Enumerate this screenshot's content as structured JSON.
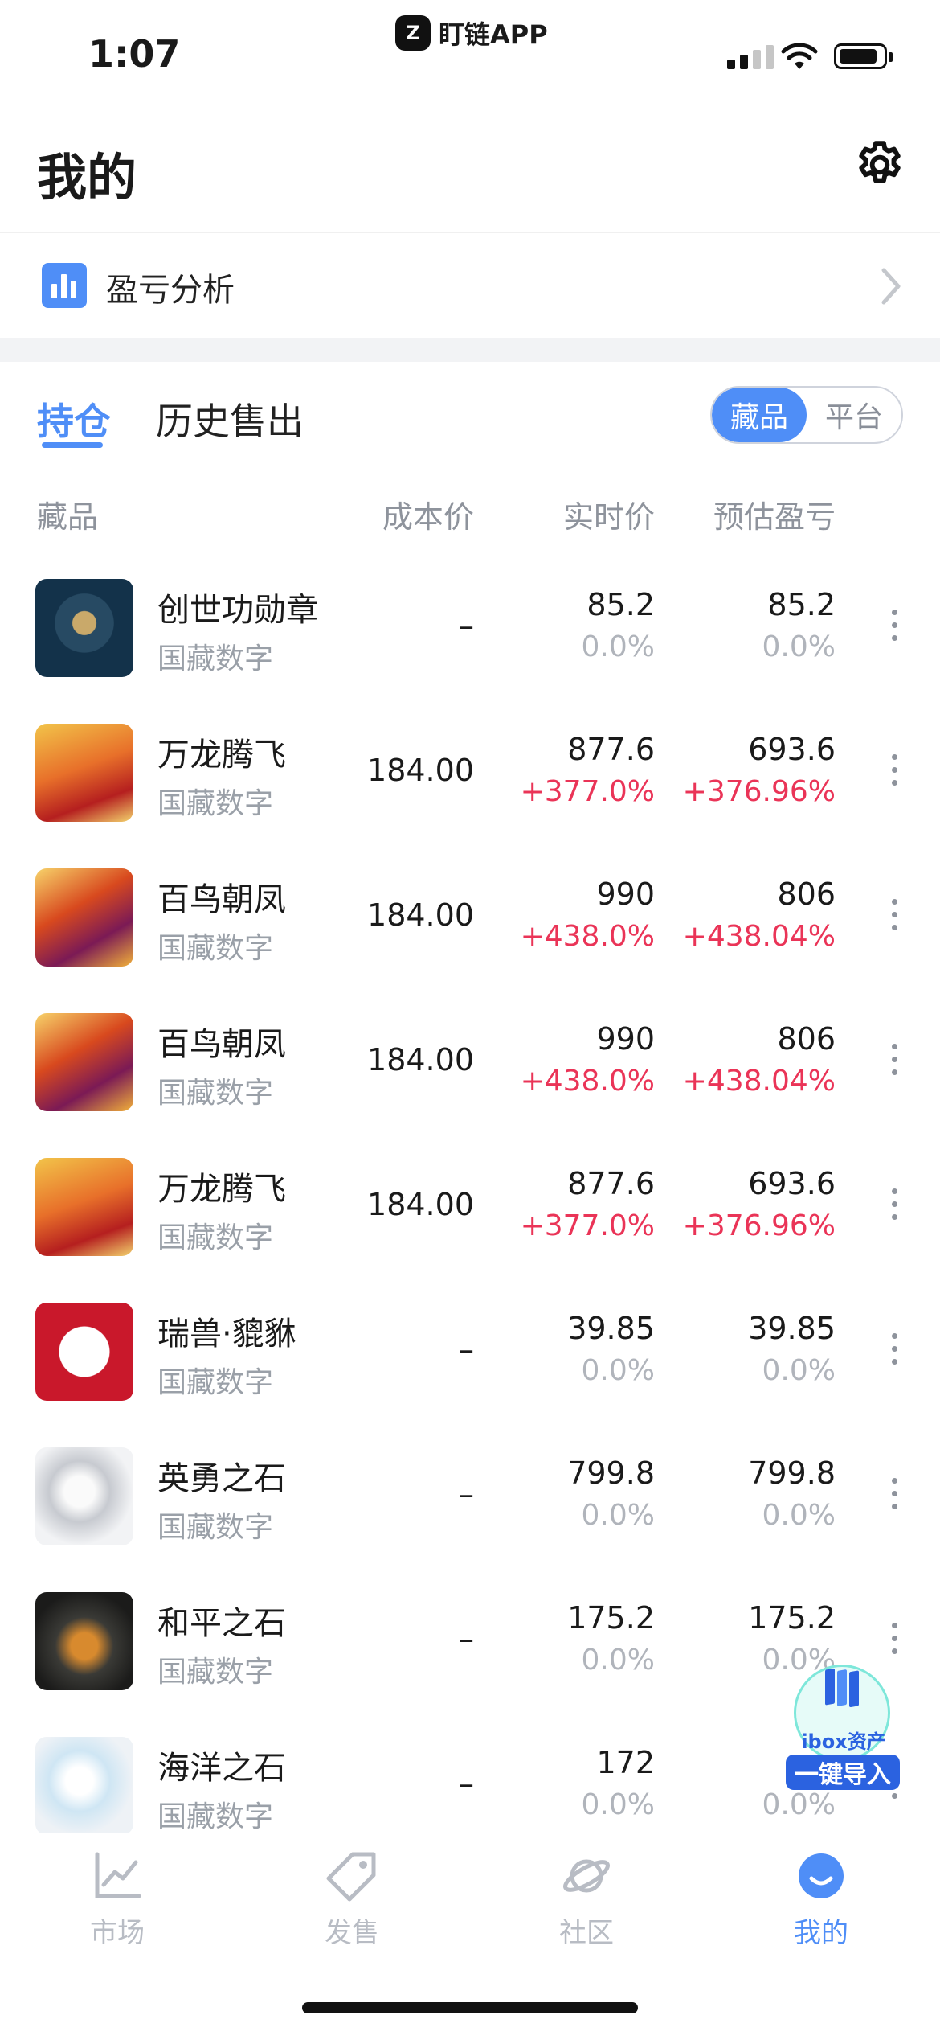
{
  "status_bar": {
    "time": "1:07",
    "app_name": "盯链APP",
    "app_logo_glyph": "Z"
  },
  "header": {
    "title": "我的",
    "settings_icon": "gear-icon"
  },
  "analysis": {
    "label": "盈亏分析",
    "icon": "bar-chart-icon",
    "accent": "#4f8ef7"
  },
  "tabs": {
    "holdings": "持仓",
    "history": "历史售出"
  },
  "segment": {
    "items": "藏品",
    "platform": "平台"
  },
  "columns": {
    "item": "藏品",
    "cost": "成本价",
    "realtime": "实时价",
    "pl": "预估盈亏"
  },
  "colors": {
    "accent": "#4f8ef7",
    "gain": "#ea3457",
    "neutral": "#b0b4bb"
  },
  "rows": [
    {
      "name": "创世功勋章",
      "platform": "国藏数字",
      "cost": "–",
      "price": "85.2",
      "price_pct": "0.0%",
      "pl": "85.2",
      "pl_pct": "0.0%",
      "trend": "flat"
    },
    {
      "name": "万龙腾飞",
      "platform": "国藏数字",
      "cost": "184.00",
      "price": "877.6",
      "price_pct": "+377.0%",
      "pl": "693.6",
      "pl_pct": "+376.96%",
      "trend": "up"
    },
    {
      "name": "百鸟朝凤",
      "platform": "国藏数字",
      "cost": "184.00",
      "price": "990",
      "price_pct": "+438.0%",
      "pl": "806",
      "pl_pct": "+438.04%",
      "trend": "up"
    },
    {
      "name": "百鸟朝凤",
      "platform": "国藏数字",
      "cost": "184.00",
      "price": "990",
      "price_pct": "+438.0%",
      "pl": "806",
      "pl_pct": "+438.04%",
      "trend": "up"
    },
    {
      "name": "万龙腾飞",
      "platform": "国藏数字",
      "cost": "184.00",
      "price": "877.6",
      "price_pct": "+377.0%",
      "pl": "693.6",
      "pl_pct": "+376.96%",
      "trend": "up"
    },
    {
      "name": "瑞兽·貔貅",
      "platform": "国藏数字",
      "cost": "–",
      "price": "39.85",
      "price_pct": "0.0%",
      "pl": "39.85",
      "pl_pct": "0.0%",
      "trend": "flat"
    },
    {
      "name": "英勇之石",
      "platform": "国藏数字",
      "cost": "–",
      "price": "799.8",
      "price_pct": "0.0%",
      "pl": "799.8",
      "pl_pct": "0.0%",
      "trend": "flat"
    },
    {
      "name": "和平之石",
      "platform": "国藏数字",
      "cost": "–",
      "price": "175.2",
      "price_pct": "0.0%",
      "pl": "175.2",
      "pl_pct": "0.0%",
      "trend": "flat"
    },
    {
      "name": "海洋之石",
      "platform": "国藏数字",
      "cost": "–",
      "price": "172",
      "price_pct": "0.0%",
      "pl": "",
      "pl_pct": "0.0%",
      "trend": "flat"
    }
  ],
  "ibox": {
    "label": "ibox资产",
    "button": "一键导入"
  },
  "tabbar": [
    {
      "label": "市场",
      "icon": "market-chart-icon"
    },
    {
      "label": "发售",
      "icon": "price-tag-icon"
    },
    {
      "label": "社区",
      "icon": "planet-icon"
    },
    {
      "label": "我的",
      "icon": "profile-icon",
      "active": true
    }
  ]
}
